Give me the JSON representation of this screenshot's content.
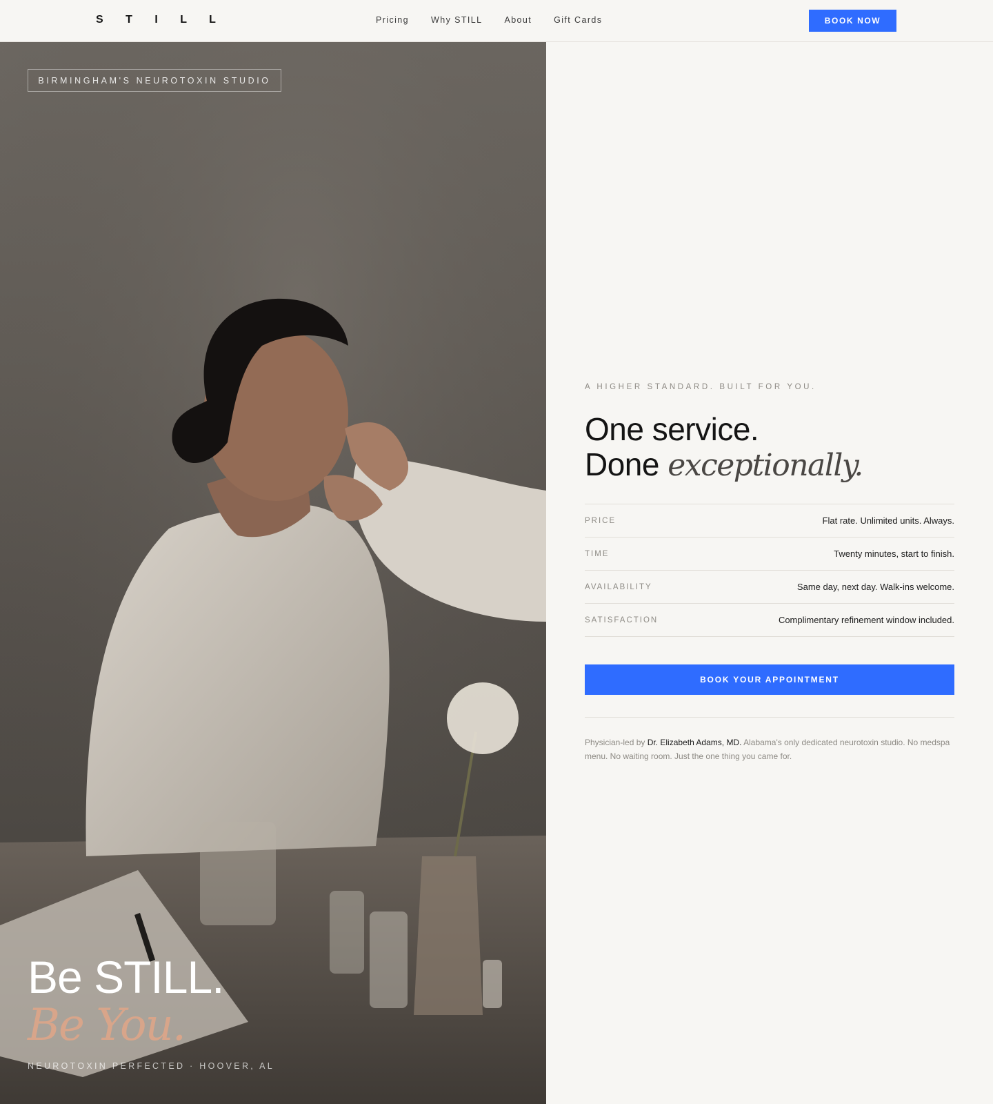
{
  "header": {
    "logo": "S T I L L",
    "nav": [
      "Pricing",
      "Why STILL",
      "About",
      "Gift Cards"
    ],
    "cta": "BOOK NOW"
  },
  "hero": {
    "badge": "BIRMINGHAM'S NEUROTOXIN STUDIO",
    "title_line1": "Be STILL.",
    "title_line2": "Be You.",
    "caption": "NEUROTOXIN PERFECTED · HOOVER, AL"
  },
  "content": {
    "kicker": "A HIGHER STANDARD. BUILT FOR YOU.",
    "headline_line1": "One service.",
    "headline_line2_plain": "Done ",
    "headline_line2_italic": "exceptionally.",
    "facts": [
      {
        "label": "PRICE",
        "value": "Flat rate. Unlimited units. Always."
      },
      {
        "label": "TIME",
        "value": "Twenty minutes, start to finish."
      },
      {
        "label": "AVAILABILITY",
        "value": "Same day, next day. Walk-ins welcome."
      },
      {
        "label": "SATISFACTION",
        "value": "Complimentary refinement window included."
      }
    ],
    "cta": "BOOK YOUR APPOINTMENT",
    "bio_prefix": "Physician-led by ",
    "bio_name": "Dr. Elizabeth Adams, MD.",
    "bio_suffix": " Alabama's only dedicated neurotoxin studio. No medspa menu. No waiting room. Just the one thing you came for."
  },
  "colors": {
    "accent": "#2f6cff",
    "hero_accent_text": "#d8a58a",
    "background": "#f7f6f3"
  }
}
